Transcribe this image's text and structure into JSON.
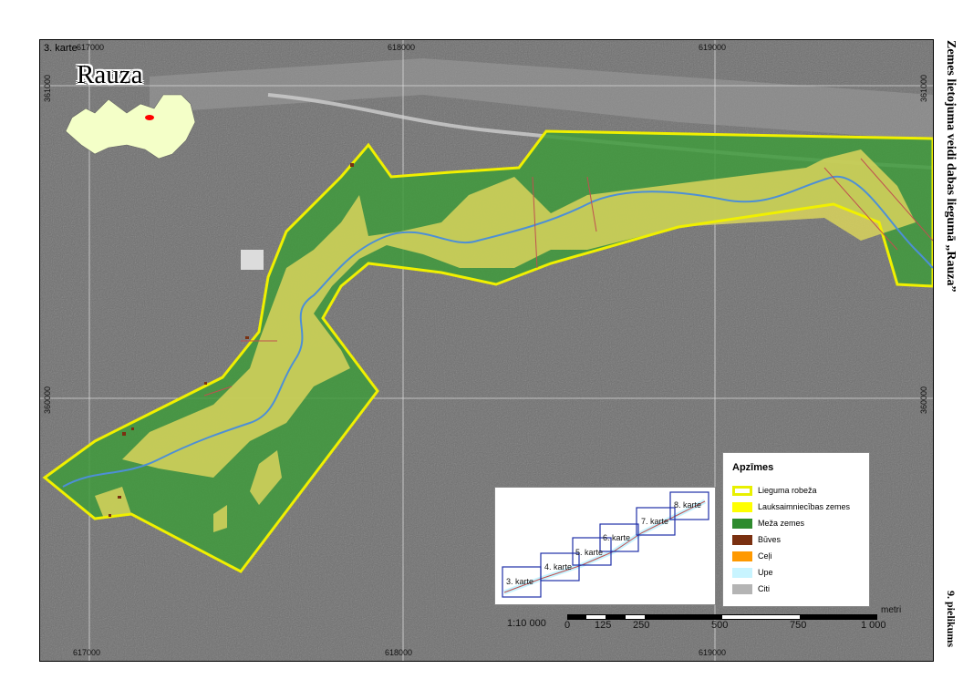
{
  "map": {
    "number_label": "3. karte",
    "title": "Rauza",
    "side_title": "Zemes lietojuma veidi dabas liegumā „Rauza”",
    "appendix": "9. pielikums",
    "coords": {
      "top": [
        "617000",
        "618000",
        "619000"
      ],
      "bottom": [
        "617000",
        "618000",
        "619000"
      ],
      "left": [
        "361000",
        "360000"
      ],
      "right": [
        "361000",
        "360000"
      ]
    }
  },
  "legend": {
    "title": "Apzīmes",
    "items": [
      {
        "label": "Lieguma robeža",
        "color": "#ffffff",
        "border": "#e8f000"
      },
      {
        "label": "Lauksaimniecības zemes",
        "color": "#ffff00"
      },
      {
        "label": "Meža zemes",
        "color": "#2e8b2e"
      },
      {
        "label": "Būves",
        "color": "#7a3010"
      },
      {
        "label": "Ceļi",
        "color": "#ff9900"
      },
      {
        "label": "Upe",
        "color": "#c8f4ff"
      },
      {
        "label": "Citi",
        "color": "#b4b4b4"
      }
    ]
  },
  "index_map": {
    "labels": [
      "3. karte",
      "4. karte",
      "5. karte",
      "6. karte",
      "7. karte",
      "8. karte"
    ]
  },
  "scale": {
    "ratio": "1:10 000",
    "unit": "metri",
    "ticks": [
      "0",
      "125",
      "250",
      "500",
      "750",
      "1 000"
    ]
  },
  "colors": {
    "agri": "#d9d45c",
    "forest": "#3f9a3c",
    "boundary": "#f0f000",
    "river": "#4d8fd6",
    "road": "#c05050"
  }
}
